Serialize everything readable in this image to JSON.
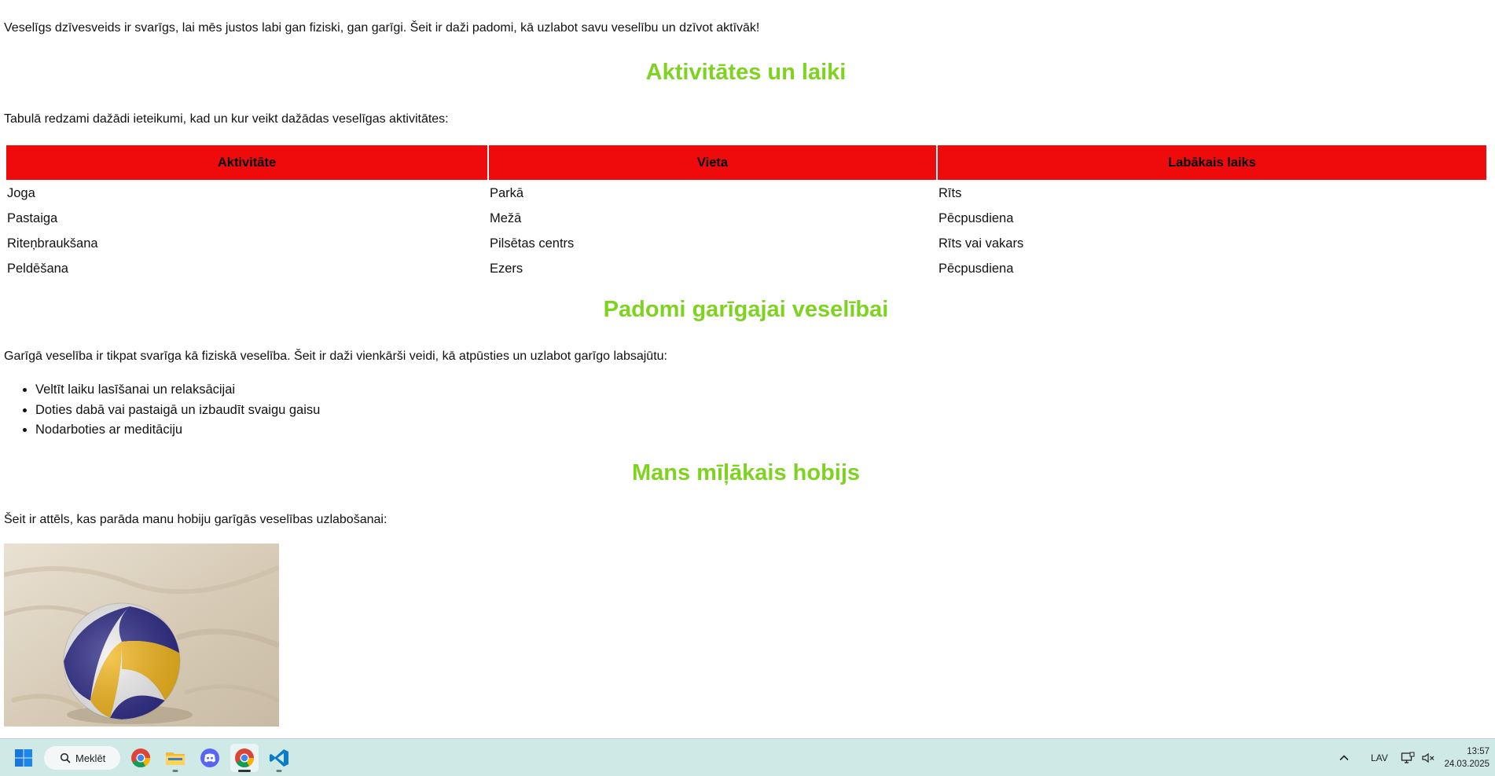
{
  "intro_text": "Veselīgs dzīvesveids ir svarīgs, lai mēs justos labi gan fiziski, gan garīgi. Šeit ir daži padomi, kā uzlabot savu veselību un dzīvot aktīvāk!",
  "sections": {
    "activities": {
      "heading": "Aktivitātes un laiki",
      "intro": "Tabulā redzami dažādi ieteikumi, kad un kur veikt dažādas veselīgas aktivitātes:",
      "columns": [
        "Aktivitāte",
        "Vieta",
        "Labākais laiks"
      ],
      "rows": [
        [
          "Joga",
          "Parkā",
          "Rīts"
        ],
        [
          "Pastaiga",
          "Mežā",
          "Pēcpusdiena"
        ],
        [
          "Riteņbraukšana",
          "Pilsētas centrs",
          "Rīts vai vakars"
        ],
        [
          "Peldēšana",
          "Ezers",
          "Pēcpusdiena"
        ]
      ],
      "header_color": "#ef0b0b"
    },
    "mental": {
      "heading": "Padomi garīgajai veselībai",
      "intro": "Garīgā veselība ir tikpat svarīga kā fiziskā veselība. Šeit ir daži vienkārši veidi, kā atpūsties un uzlabot garīgo labsajūtu:",
      "tips": [
        "Veltīt laiku lasīšanai un relaksācijai",
        "Doties dabā vai pastaigā un izbaudīt svaigu gaisu",
        "Nodarboties ar meditāciju"
      ]
    },
    "hobby": {
      "heading": "Mans mīļākais hobijs",
      "intro": "Šeit ir attēls, kas parāda manu hobiju garīgās veselības uzlabošanai:",
      "image_subject": "volleyball on sand"
    }
  },
  "heading_color": "#7ed321",
  "taskbar": {
    "search_label": "Meklēt",
    "apps": [
      "start-icon",
      "chrome-icon",
      "file-explorer-icon",
      "discord-icon",
      "chrome-icon",
      "vscode-icon"
    ],
    "language": "LAV",
    "time": "13:57",
    "date": "24.03.2025"
  }
}
